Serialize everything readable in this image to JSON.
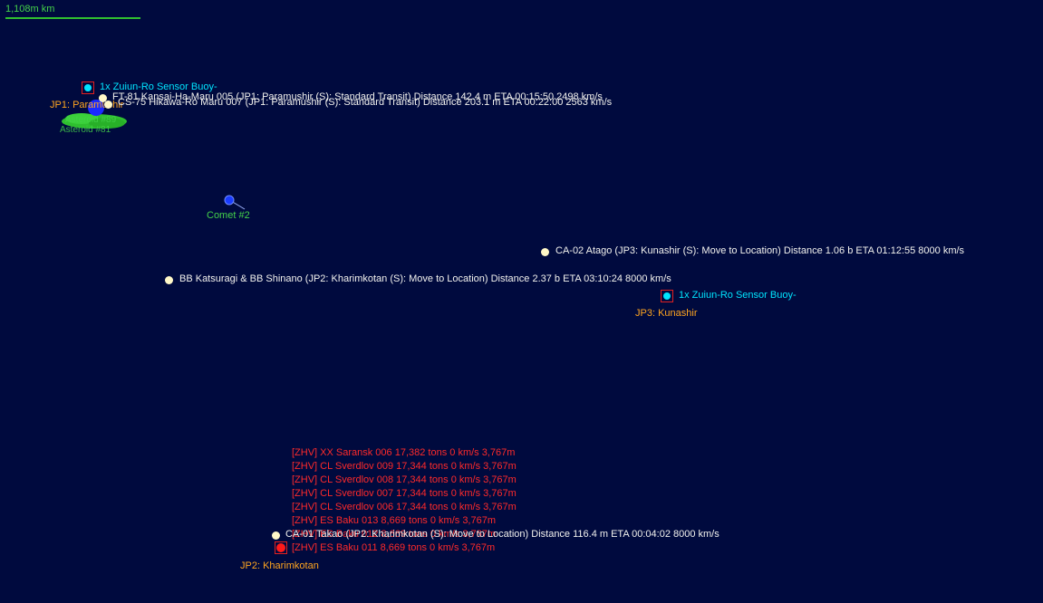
{
  "scale": {
    "label": "1,108m km"
  },
  "bodies": {
    "jp1_label": "JP1: Paramushir",
    "asteroid_label_1": "Asteroid #89",
    "asteroid_label_2": "Asteroid #81",
    "comet_label": "Comet #2",
    "jp3_label": "JP3: Kunashir",
    "jp2_label": "JP2: Kharimkotan"
  },
  "buoys": {
    "buoy_1": "1x Zuiun-Ro Sensor Buoy-",
    "buoy_2": "1x Zuiun-Ro Sensor Buoy-"
  },
  "fleets": {
    "ft81": "FT-81 Kansai-Ha-Maru 005  (JP1: Paramushir (S): Standard Transit)   Distance 142.4 m   ETA 00:15:50   2498 km/s",
    "cs75": "CS-75 Hikawa-Ro Maru 007  (JP1: Paramushir (S): Standard Transit)   Distance 203.1 m   ETA 00:22:00   2563 km/s",
    "ca02": "CA-02 Atago  (JP3: Kunashir (S): Move to Location)   Distance 1.06 b   ETA 01:12:55   8000 km/s",
    "bb": "BB Katsuragi & BB Shinano  (JP2: Kharimkotan (S): Move to Location)   Distance 2.37 b   ETA 03:10:24   8000 km/s",
    "ca01": "CA-01 Takao  (JP2: Kharimkotan (S): Move to Location)   Distance 116.4 m   ETA 00:04:02   8000 km/s"
  },
  "contacts": [
    "[ZHV]  XX Saransk 006  17,382 tons   0 km/s  3,767m",
    "[ZHV]  CL Sverdlov 009  17,344 tons   0 km/s  3,767m",
    "[ZHV]  CL Sverdlov 008  17,344 tons   0 km/s  3,767m",
    "[ZHV]  CL Sverdlov 007  17,344 tons   0 km/s  3,767m",
    "[ZHV]  CL Sverdlov 006  17,344 tons   0 km/s  3,767m",
    "[ZHV]  ES Baku 013  8,669 tons   0 km/s  3,767m",
    "[ZHV]  ES Baku 012  8,669 tons   0 km/s  3,767m",
    "[ZHV]  ES Baku 011  8,669 tons   0 km/s  3,767m"
  ],
  "colors": {
    "background": "#000a3e",
    "fleet_text": "#f2f2ee",
    "buoy_text": "#00e5ff",
    "jump_point_text": "#ffa51f",
    "body_text": "#44d24a",
    "contact_text": "#ff2a2a"
  }
}
